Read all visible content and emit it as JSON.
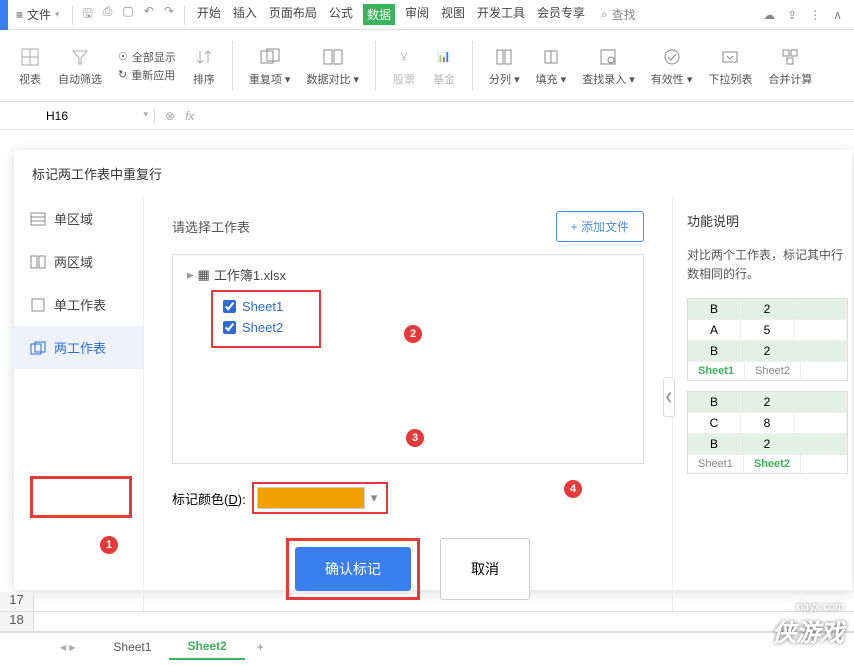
{
  "topbar": {
    "file_label": "文件",
    "tabs": [
      "开始",
      "插入",
      "页面布局",
      "公式",
      "数据",
      "审阅",
      "视图",
      "开发工具",
      "会员专享"
    ],
    "active_tab_index": 4,
    "search_label": "查找"
  },
  "ribbon": {
    "view_table": "视表",
    "auto_filter": "自动筛选",
    "show_all": "全部显示",
    "reapply": "重新应用",
    "sort": "排序",
    "duplicates": "重复项",
    "data_compare": "数据对比",
    "stocks": "股票",
    "funds": "基金",
    "split_col": "分列",
    "fill": "填充",
    "find_entry": "查找录入",
    "validity": "有效性",
    "dropdown_list": "下拉列表",
    "consolidate": "合并计算"
  },
  "formula_bar": {
    "cell_ref": "H16"
  },
  "dialog": {
    "title": "标记两工作表中重复行",
    "sidebar": {
      "items": [
        {
          "label": "单区域"
        },
        {
          "label": "两区域"
        },
        {
          "label": "单工作表"
        },
        {
          "label": "两工作表"
        }
      ],
      "active_index": 3
    },
    "main": {
      "select_label": "请选择工作表",
      "add_file": "+ 添加文件",
      "workbook": "工作簿1.xlsx",
      "sheets": [
        "Sheet1",
        "Sheet2"
      ],
      "color_label_prefix": "标记颜色(",
      "color_label_key": "D",
      "color_label_suffix": "):",
      "color": "#f0a000",
      "confirm": "确认标记",
      "cancel": "取消"
    },
    "info": {
      "heading": "功能说明",
      "desc": "对比两个工作表，标记其中行数相同的行。",
      "table1": {
        "rows": [
          [
            "B",
            "2"
          ],
          [
            "A",
            "5"
          ],
          [
            "B",
            "2"
          ]
        ],
        "hl": [
          0,
          2
        ],
        "tabs": [
          "Sheet1",
          "Sheet2"
        ],
        "active": 0
      },
      "table2": {
        "rows": [
          [
            "B",
            "2"
          ],
          [
            "C",
            "8"
          ],
          [
            "B",
            "2"
          ]
        ],
        "hl": [
          0,
          2
        ],
        "tabs": [
          "Sheet1",
          "Sheet2"
        ],
        "active": 1
      }
    }
  },
  "annotations": [
    "1",
    "2",
    "3",
    "4"
  ],
  "bottom": {
    "rows": [
      "17",
      "18"
    ],
    "tabs": [
      "Sheet1",
      "Sheet2"
    ],
    "active_tab": 1
  },
  "watermark": {
    "url": "xiayx.com",
    "text": "侠游戏"
  }
}
